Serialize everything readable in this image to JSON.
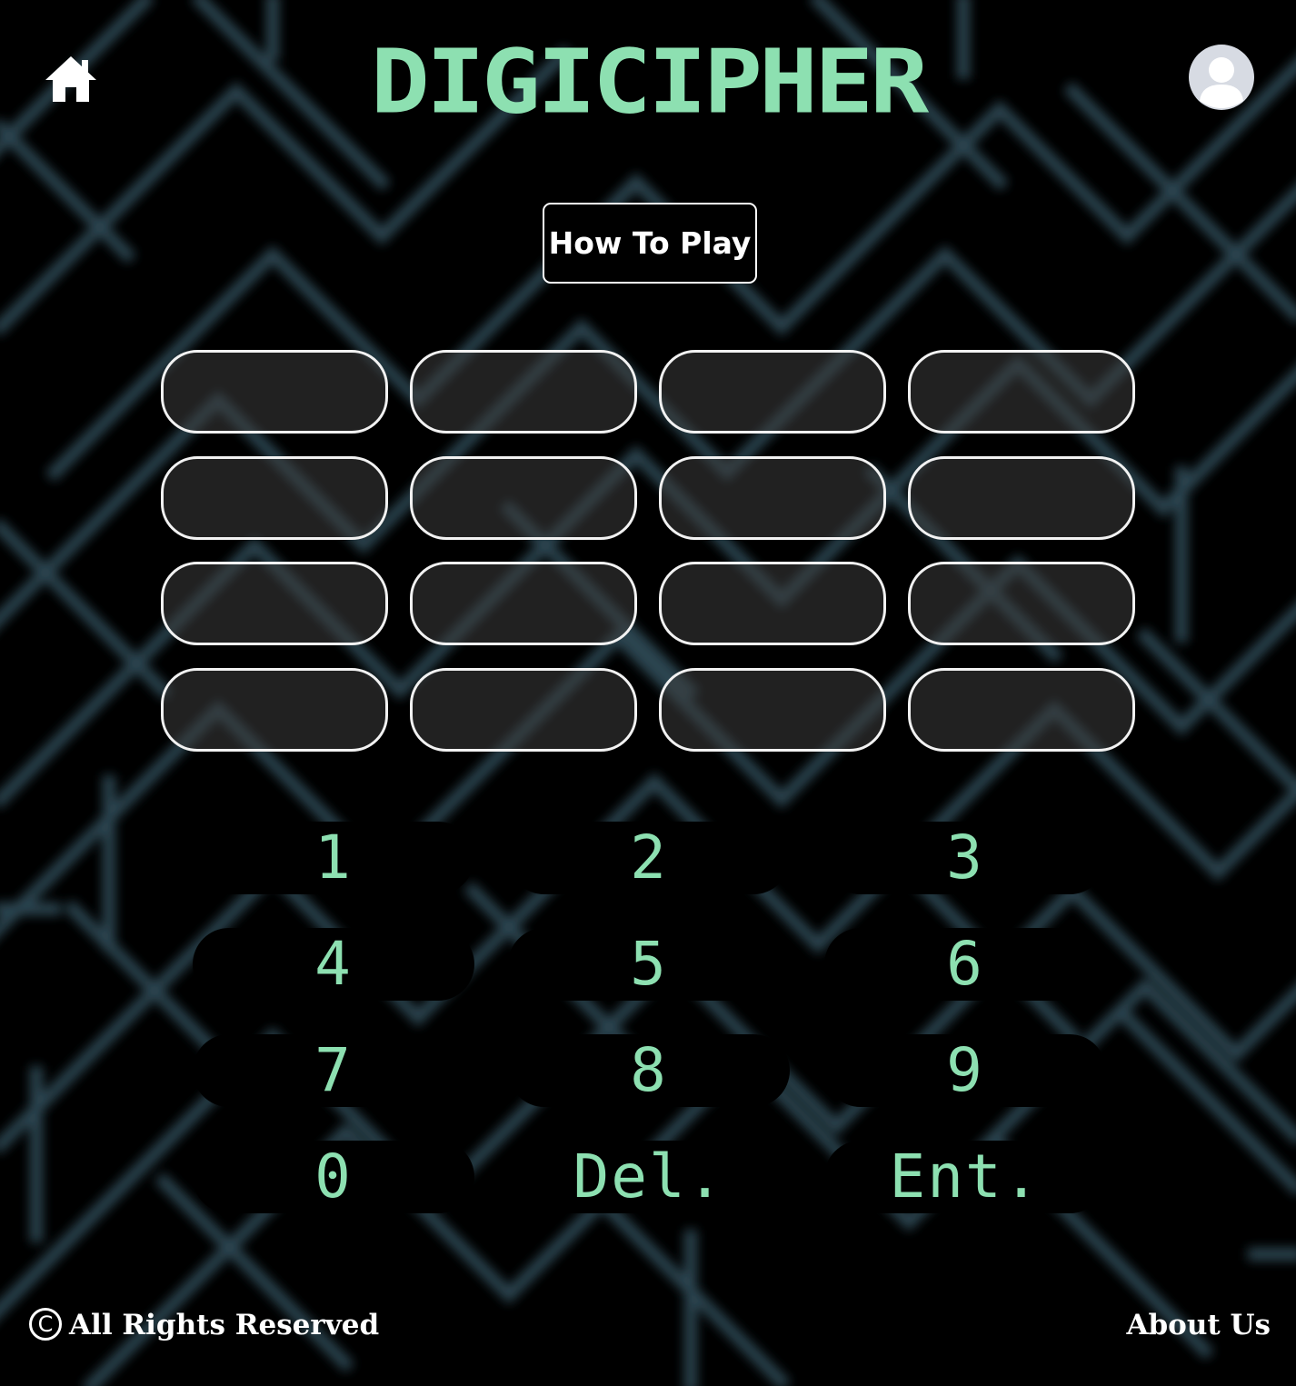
{
  "header": {
    "title": "DIGICIPHER",
    "home_icon": "home-icon",
    "avatar_icon": "user-avatar-icon"
  },
  "how_to_play": {
    "label": "How To Play"
  },
  "guess_grid": {
    "rows": [
      [
        "",
        "",
        "",
        ""
      ],
      [
        "",
        "",
        "",
        ""
      ],
      [
        "",
        "",
        "",
        ""
      ],
      [
        "",
        "",
        "",
        ""
      ]
    ]
  },
  "keypad": {
    "keys": [
      "1",
      "2",
      "3",
      "4",
      "5",
      "6",
      "7",
      "8",
      "9",
      "0",
      "Del.",
      "Ent."
    ]
  },
  "footer": {
    "copyright_symbol": "C",
    "copyright_text": "All Rights Reserved",
    "about_label": "About Us"
  },
  "colors": {
    "accent": "#8de0b1",
    "background": "#000000",
    "maze_lines": "#2e4a55",
    "slot_border": "#f2f2f2"
  }
}
